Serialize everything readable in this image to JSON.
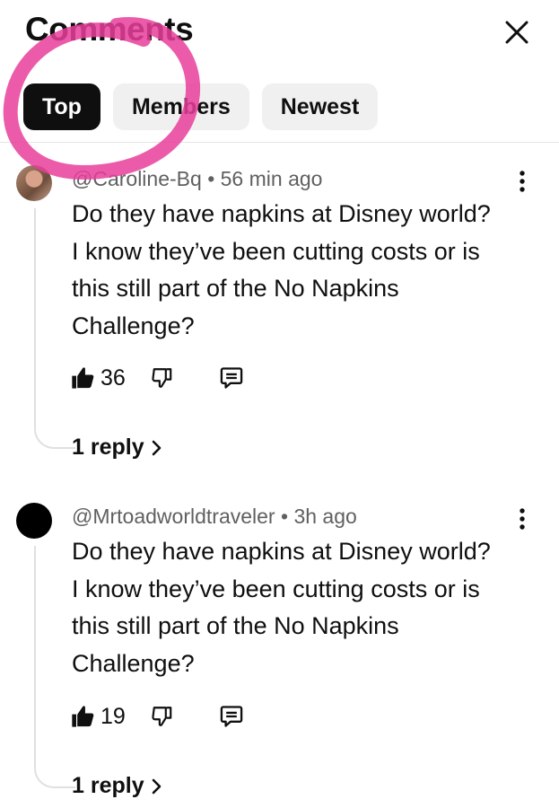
{
  "header": {
    "title": "Comments"
  },
  "filters": [
    {
      "label": "Top",
      "active": true
    },
    {
      "label": "Members",
      "active": false
    },
    {
      "label": "Newest",
      "active": false
    }
  ],
  "colors": {
    "highlight": "#e83e9b",
    "chip_active": "#0f0f0f",
    "chip": "#f0f0f0"
  },
  "comments": [
    {
      "author": "@Caroline-Bq",
      "time": "56 min ago",
      "text": "Do they have napkins at Disney world? I know they’ve been cutting costs or is this still part of the No Napkins Challenge?",
      "likes": "36",
      "replies": "1 reply",
      "avatar": "photo"
    },
    {
      "author": "@Mrtoadworldtraveler",
      "time": "3h ago",
      "text": "Do they have napkins at Disney world? I know they’ve been cutting costs or is this still part of the No Napkins Challenge?",
      "likes": "19",
      "replies": "1 reply",
      "avatar": "black"
    }
  ]
}
